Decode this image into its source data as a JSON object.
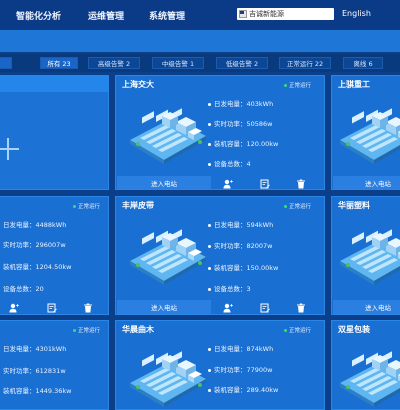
{
  "nav": {
    "items": [
      "智能化分析",
      "运维管理",
      "系统管理"
    ],
    "brand": "吉诚新能源",
    "language": "English"
  },
  "filters": [
    {
      "label": "所有 23",
      "active": true
    },
    {
      "label": "高级告警 2",
      "active": false
    },
    {
      "label": "中级告警 1",
      "active": false
    },
    {
      "label": "低级告警 2",
      "active": false
    },
    {
      "label": "正常运行 22",
      "active": false
    },
    {
      "label": "离线 6",
      "active": false
    }
  ],
  "cards": {
    "top_left": {},
    "top_center": {
      "title": "上海交大",
      "status": "正常运行",
      "daily_gen": "日发电量：403kWh",
      "realtime_power": "实时功率：50586w",
      "capacity": "装机容量：120.00kw",
      "device_count": "设备总数：4",
      "enter": "进入电站"
    },
    "top_right": {
      "title": "上骐重工",
      "status": "正常运行",
      "enter": "进入电站"
    },
    "mid_left": {
      "status": "正常运行",
      "daily_gen": "日发电量：4488kWh",
      "realtime_power": "实时功率：296007w",
      "capacity": "装机容量：1204.50kw",
      "device_count": "设备总数：20"
    },
    "mid_center": {
      "title": "丰岸皮带",
      "status": "正常运行",
      "daily_gen": "日发电量：594kWh",
      "realtime_power": "实时功率：82007w",
      "capacity": "装机容量：150.00kw",
      "device_count": "设备总数：3",
      "enter": "进入电站"
    },
    "mid_right": {
      "title": "华丽塑料",
      "status": "正常运行",
      "enter": "进入电站"
    },
    "bot_left": {
      "status": "正常运行",
      "daily_gen": "日发电量：4301kWh",
      "realtime_power": "实时功率：612831w",
      "capacity": "装机容量：1449.36kw"
    },
    "bot_center": {
      "title": "华晨曲木",
      "status": "正常运行",
      "daily_gen": "日发电量：874kWh",
      "realtime_power": "实时功率：77900w",
      "capacity": "装机容量：289.40kw"
    },
    "bot_right": {
      "title": "双星包装",
      "status": "正常运行"
    }
  },
  "icons": [
    "add-user-icon",
    "edit-icon",
    "delete-icon",
    "plus-icon",
    "solar-plant-icon"
  ],
  "colors": {
    "topbar": "#0b3a86",
    "band": "#1e76d6",
    "card": "#1a6fd2",
    "status_dot": "#33e07a"
  }
}
